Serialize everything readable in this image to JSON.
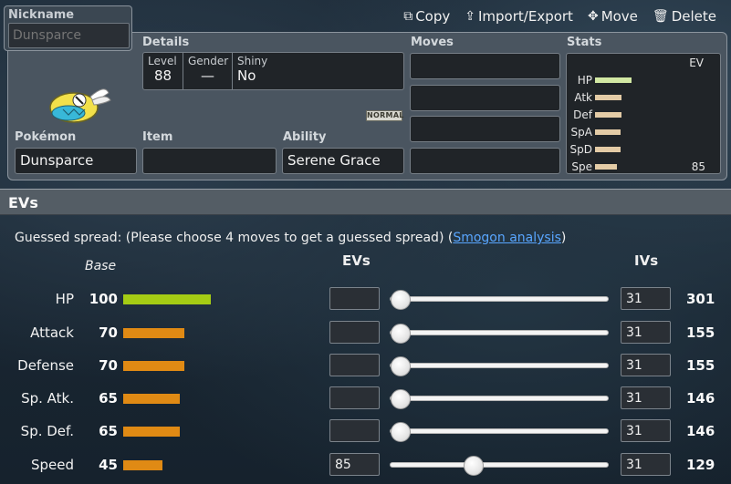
{
  "nickname": {
    "label": "Nickname",
    "placeholder": "Dunsparce"
  },
  "actions": [
    {
      "label": "Copy",
      "icon": "copy-icon"
    },
    {
      "label": "Import/Export",
      "icon": "upload-icon"
    },
    {
      "label": "Move",
      "icon": "move-arrows-icon"
    },
    {
      "label": "Delete",
      "icon": "trash-icon"
    }
  ],
  "panel": {
    "details_label": "Details",
    "details": {
      "level_label": "Level",
      "level": "88",
      "gender_label": "Gender",
      "gender": "—",
      "shiny_label": "Shiny",
      "shiny": "No"
    },
    "type_badge": "NORMAL",
    "pokemon_label": "Pokémon",
    "pokemon": "Dunsparce",
    "item_label": "Item",
    "item": "",
    "ability_label": "Ability",
    "ability": "Serene Grace",
    "moves_label": "Moves",
    "moves": [
      "",
      "",
      "",
      ""
    ],
    "stats_label": "Stats",
    "stats_ev_head": "EV",
    "stats": [
      {
        "name": "HP",
        "bar_fraction": 0.33,
        "color": "#d2e8a4",
        "ev": ""
      },
      {
        "name": "Atk",
        "bar_fraction": 0.24,
        "color": "#e3cba6",
        "ev": ""
      },
      {
        "name": "Def",
        "bar_fraction": 0.24,
        "color": "#e3cba6",
        "ev": ""
      },
      {
        "name": "SpA",
        "bar_fraction": 0.23,
        "color": "#e3cba6",
        "ev": ""
      },
      {
        "name": "SpD",
        "bar_fraction": 0.23,
        "color": "#e3cba6",
        "ev": ""
      },
      {
        "name": "Spe",
        "bar_fraction": 0.2,
        "color": "#e3cba6",
        "ev": "85"
      }
    ]
  },
  "evs_section": {
    "title": "EVs",
    "guess_text": "Guessed spread: (Please choose 4 moves to get a guessed spread) (",
    "guess_link": "Smogon analysis",
    "guess_close": ")",
    "base_head": "Base",
    "evs_head": "EVs",
    "ivs_head": "IVs",
    "rows": [
      {
        "name": "HP",
        "base": "100",
        "base_color": "#a5cc14",
        "ev": "",
        "ev_fraction": 0.0,
        "iv": "31",
        "total": "301"
      },
      {
        "name": "Attack",
        "base": "70",
        "base_color": "#e08a14",
        "ev": "",
        "ev_fraction": 0.0,
        "iv": "31",
        "total": "155"
      },
      {
        "name": "Defense",
        "base": "70",
        "base_color": "#e08a14",
        "ev": "",
        "ev_fraction": 0.0,
        "iv": "31",
        "total": "155"
      },
      {
        "name": "Sp. Atk.",
        "base": "65",
        "base_color": "#e08a14",
        "ev": "",
        "ev_fraction": 0.0,
        "iv": "31",
        "total": "146"
      },
      {
        "name": "Sp. Def.",
        "base": "65",
        "base_color": "#e08a14",
        "ev": "",
        "ev_fraction": 0.0,
        "iv": "31",
        "total": "146"
      },
      {
        "name": "Speed",
        "base": "45",
        "base_color": "#e08a14",
        "ev": "85",
        "ev_fraction": 0.333,
        "iv": "31",
        "total": "129"
      }
    ]
  }
}
